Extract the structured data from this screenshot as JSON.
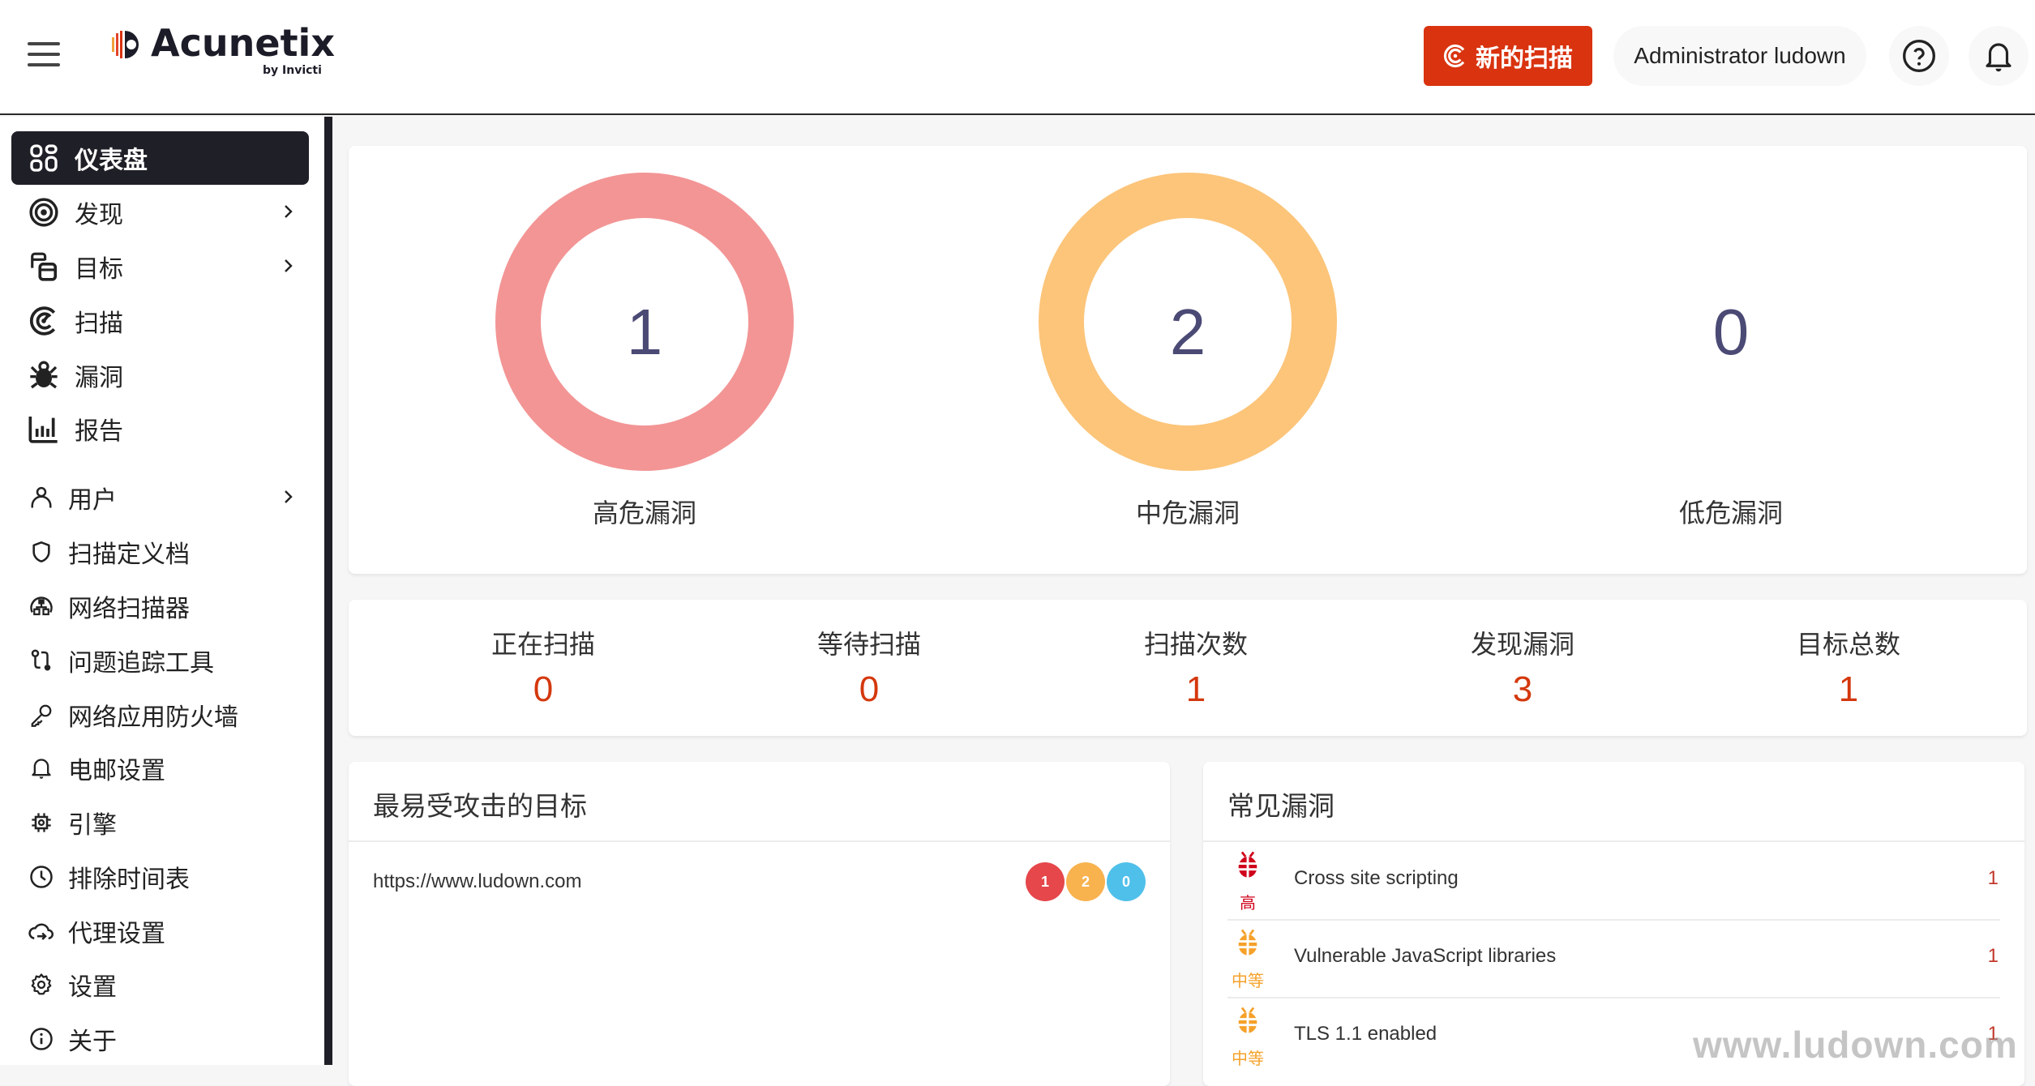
{
  "header": {
    "logo_text": "Acunetix",
    "logo_sub": "by Invicti",
    "new_scan_label": "新的扫描",
    "user_label": "Administrator ludown",
    "brand_color": "#d9330f"
  },
  "sidebar": {
    "items": [
      {
        "label": "仪表盘",
        "icon": "dashboard-icon",
        "active": true
      },
      {
        "label": "发现",
        "icon": "target-icon",
        "has_submenu": true
      },
      {
        "label": "目标",
        "icon": "targets-icon",
        "has_submenu": true
      },
      {
        "label": "扫描",
        "icon": "scan-icon"
      },
      {
        "label": "漏洞",
        "icon": "bug-icon"
      },
      {
        "label": "报告",
        "icon": "report-chart-icon"
      },
      {
        "label": "用户",
        "icon": "user-icon",
        "has_submenu": true
      },
      {
        "label": "扫描定义档",
        "icon": "shield-icon"
      },
      {
        "label": "网络扫描器",
        "icon": "network-scanner-icon"
      },
      {
        "label": "问题追踪工具",
        "icon": "issue-tracker-icon"
      },
      {
        "label": "网络应用防火墙",
        "icon": "key-icon"
      },
      {
        "label": "电邮设置",
        "icon": "bell-icon"
      },
      {
        "label": "引擎",
        "icon": "chip-icon"
      },
      {
        "label": "排除时间表",
        "icon": "clock-icon"
      },
      {
        "label": "代理设置",
        "icon": "cloud-arrow-icon"
      },
      {
        "label": "设置",
        "icon": "gear-icon"
      },
      {
        "label": "关于",
        "icon": "info-icon"
      }
    ]
  },
  "severity_summary": [
    {
      "label": "高危漏洞",
      "value": "1",
      "color": "#f39595",
      "ring": true
    },
    {
      "label": "中危漏洞",
      "value": "2",
      "color": "#fcc57a",
      "ring": true
    },
    {
      "label": "低危漏洞",
      "value": "0",
      "color": "#5bc0eb",
      "ring": false
    }
  ],
  "stats": [
    {
      "label": "正在扫描",
      "value": "0"
    },
    {
      "label": "等待扫描",
      "value": "0"
    },
    {
      "label": "扫描次数",
      "value": "1"
    },
    {
      "label": "发现漏洞",
      "value": "3"
    },
    {
      "label": "目标总数",
      "value": "1"
    }
  ],
  "top_targets": {
    "title": "最易受攻击的目标",
    "rows": [
      {
        "url": "https://www.ludown.com",
        "high": "1",
        "medium": "2",
        "low": "0"
      }
    ]
  },
  "common_vulns": {
    "title": "常见漏洞",
    "rows": [
      {
        "severity": "高",
        "severity_color": "#d0021b",
        "name": "Cross site scripting",
        "count": "1"
      },
      {
        "severity": "中等",
        "severity_color": "#f5a12a",
        "name": "Vulnerable JavaScript libraries",
        "count": "1"
      },
      {
        "severity": "中等",
        "severity_color": "#f5a12a",
        "name": "TLS 1.1 enabled",
        "count": "1"
      }
    ]
  },
  "watermark": "www.ludown.com"
}
